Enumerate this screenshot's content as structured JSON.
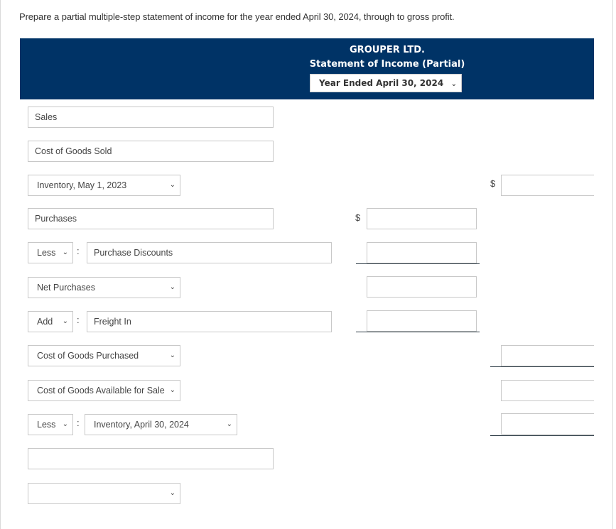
{
  "instruction": "Prepare a partial multiple-step statement of income for the year ended April 30, 2024, through to gross profit.",
  "header": {
    "company": "GROUPER LTD.",
    "title": "Statement of Income (Partial)",
    "period_select": "Year Ended April 30, 2024"
  },
  "rows": {
    "sales": "Sales",
    "cogs": "Cost of Goods Sold",
    "inv_begin": "Inventory, May 1, 2023",
    "purchases": "Purchases",
    "less_op_1": "Less",
    "purchase_discounts": "Purchase Discounts",
    "net_purchases": "Net Purchases",
    "add_op": "Add",
    "freight_in": "Freight In",
    "cogp": "Cost of Goods Purchased",
    "cogafs": "Cost of Goods Available for Sale",
    "less_op_2": "Less",
    "inv_end": "Inventory, April 30, 2024",
    "blank_text": "",
    "blank_select": ""
  },
  "currency_symbol": "$",
  "colon": ":",
  "icons": {
    "chevron": "⌄"
  }
}
